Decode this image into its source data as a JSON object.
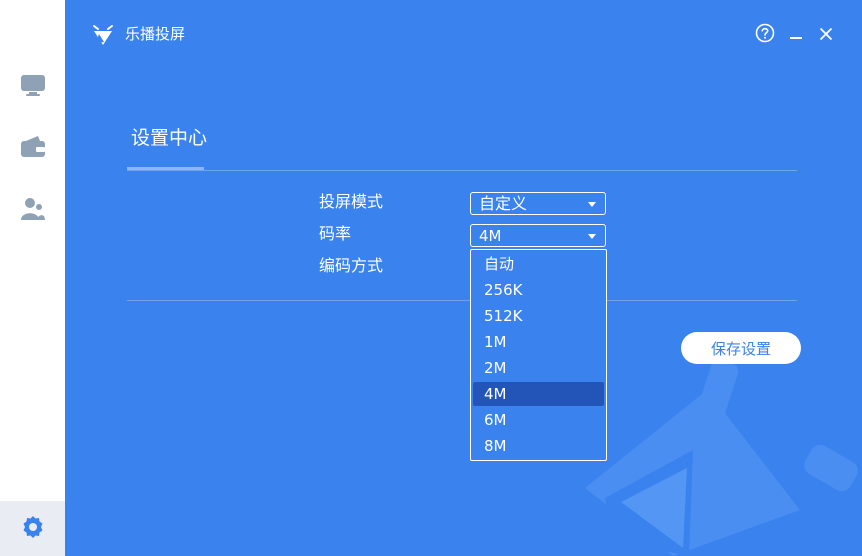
{
  "app": {
    "title": "乐播投屏"
  },
  "titlebar": {
    "help_icon": "help-circle-icon",
    "minimize_icon": "minimize-icon",
    "close_icon": "close-icon"
  },
  "sidebar": {
    "items": [
      {
        "icon": "monitor-icon"
      },
      {
        "icon": "wallet-icon"
      },
      {
        "icon": "users-icon"
      },
      {
        "icon": "gear-icon",
        "active": true
      }
    ]
  },
  "settings": {
    "title": "设置中心",
    "rows": [
      {
        "label": "投屏模式",
        "value": "自定义"
      },
      {
        "label": "码率",
        "value": "4M"
      },
      {
        "label": "编码方式"
      }
    ],
    "bitrate_options": [
      "自动",
      "256K",
      "512K",
      "1M",
      "2M",
      "4M",
      "6M",
      "8M"
    ],
    "selected_option": "4M",
    "save_label": "保存设置"
  },
  "colors": {
    "background": "#3a82ee",
    "selected": "#2355b8",
    "sidebar": "#ffffff"
  }
}
